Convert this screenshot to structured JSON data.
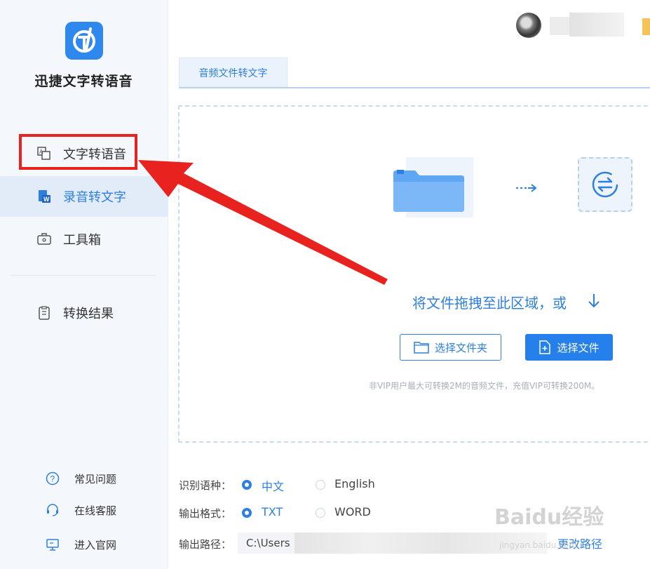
{
  "app": {
    "title": "迅捷文字转语音"
  },
  "sidebar": {
    "items": [
      {
        "label": "文字转语音",
        "icon": "text-to-speech-icon"
      },
      {
        "label": "录音转文字",
        "icon": "word-document-icon"
      },
      {
        "label": "工具箱",
        "icon": "toolbox-icon"
      },
      {
        "label": "转换结果",
        "icon": "result-list-icon"
      }
    ],
    "bottom_links": [
      {
        "label": "常见问题",
        "icon": "help-circle-icon"
      },
      {
        "label": "在线客服",
        "icon": "headset-icon"
      },
      {
        "label": "进入官网",
        "icon": "monitor-icon"
      }
    ]
  },
  "tabs": [
    {
      "label": "音频文件转文字"
    }
  ],
  "dropzone": {
    "instruction": "将文件拖拽至此区域，或",
    "select_folder": "选择文件夹",
    "select_file": "选择文件",
    "hint": "非VIP用户最大可转换2M的音频文件，充值VIP可转换200M。"
  },
  "options": {
    "language_label": "识别语种：",
    "languages": [
      {
        "label": "中文",
        "selected": true
      },
      {
        "label": "English",
        "selected": false
      }
    ],
    "format_label": "输出格式：",
    "formats": [
      {
        "label": "TXT",
        "selected": true
      },
      {
        "label": "WORD",
        "selected": false
      }
    ],
    "path_label": "输出路径：",
    "path_value": "C:\\Users",
    "change_path": "更改路径"
  },
  "watermark": {
    "brand": "Baidu经验",
    "url": "jingyan.baidu.com"
  },
  "colors": {
    "accent": "#2f7fe0",
    "highlight": "#e8231f",
    "sidebar_bg": "#f4f8fc"
  }
}
